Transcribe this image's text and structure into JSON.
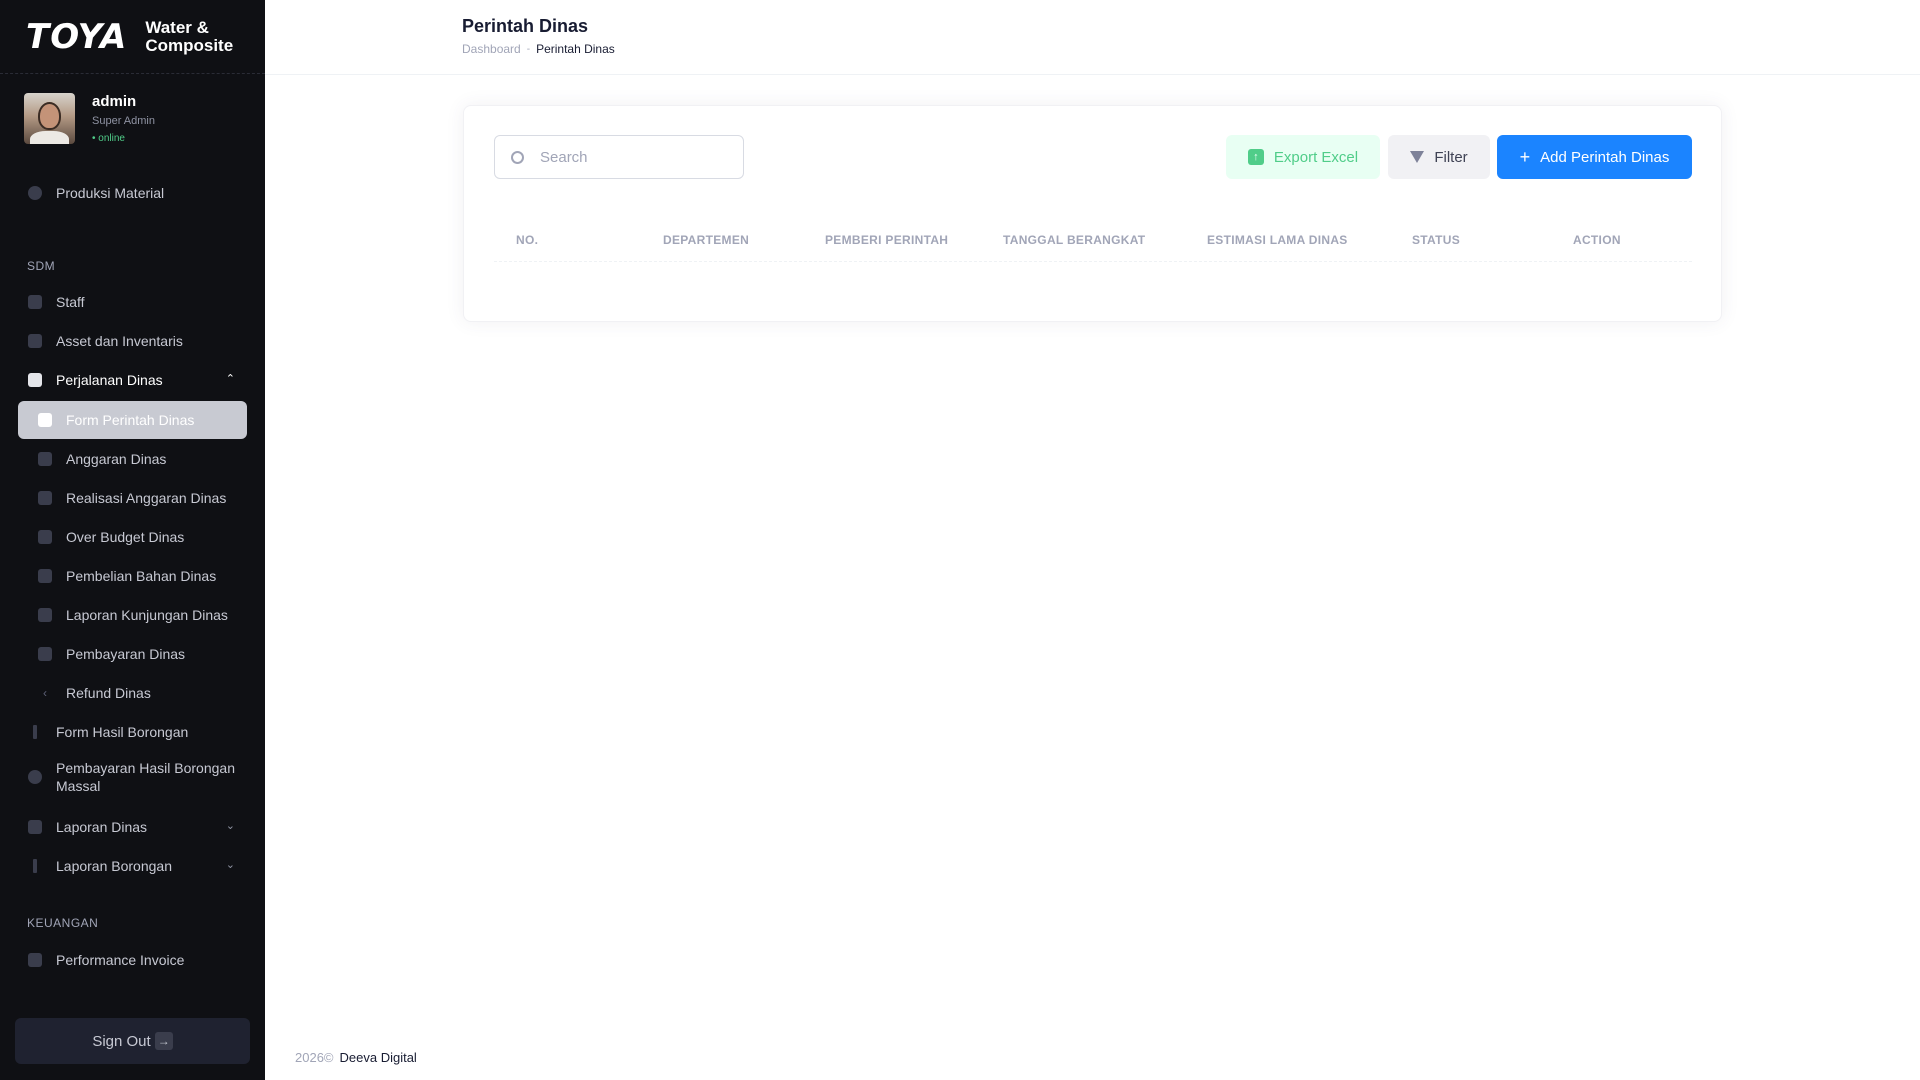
{
  "brand": {
    "logo": "TOYA",
    "subtitle_line1": "Water &",
    "subtitle_line2": "Composite"
  },
  "user": {
    "name": "admin",
    "role": "Super Admin",
    "status": "• online"
  },
  "sidebar": {
    "items": [
      {
        "label": "Produksi Material",
        "icon": "circle-icon"
      },
      {
        "label": "Staff",
        "icon": "user-icon"
      },
      {
        "label": "Asset dan Inventaris",
        "icon": "layers-icon"
      },
      {
        "label": "Perjalanan Dinas",
        "icon": "briefcase-icon"
      },
      {
        "label": "Form Perintah Dinas",
        "icon": "form-icon"
      },
      {
        "label": "Anggaran Dinas",
        "icon": "calendar-icon"
      },
      {
        "label": "Realisasi Anggaran Dinas",
        "icon": "wallet-icon"
      },
      {
        "label": "Over Budget Dinas",
        "icon": "chart-icon"
      },
      {
        "label": "Pembelian Bahan Dinas",
        "icon": "scissors-icon"
      },
      {
        "label": "Laporan Kunjungan Dinas",
        "icon": "location-icon"
      },
      {
        "label": "Pembayaran Dinas",
        "icon": "card-icon"
      },
      {
        "label": "Refund Dinas",
        "icon": "chevron-left-icon"
      },
      {
        "label": "Form Hasil Borongan",
        "icon": "bar-icon"
      },
      {
        "label": "Pembayaran Hasil Borongan Massal",
        "icon": "dollar-icon"
      },
      {
        "label": "Laporan Dinas",
        "icon": "briefcase-icon"
      },
      {
        "label": "Laporan Borongan",
        "icon": "bar-icon"
      },
      {
        "label": "Performance Invoice",
        "icon": "document-icon"
      }
    ],
    "sections": {
      "sdm": "SDM",
      "keuangan": "KEUANGAN"
    },
    "sign_out": "Sign Out"
  },
  "header": {
    "title": "Perintah Dinas",
    "breadcrumb": {
      "home": "Dashboard",
      "current": "Perintah Dinas"
    }
  },
  "toolbar": {
    "search_placeholder": "Search",
    "export_label": "Export Excel",
    "filter_label": "Filter",
    "add_label": "Add Perintah Dinas"
  },
  "table": {
    "columns": [
      "NO.",
      "DEPARTEMEN",
      "PEMBERI PERINTAH",
      "TANGGAL BERANGKAT",
      "ESTIMASI LAMA DINAS",
      "STATUS",
      "ACTION"
    ],
    "rows": []
  },
  "footer": {
    "year": "2026©",
    "company": "Deeva Digital"
  },
  "colors": {
    "primary": "#1b84ff",
    "success": "#50cd89",
    "sidebar_bg": "#0f1014"
  }
}
